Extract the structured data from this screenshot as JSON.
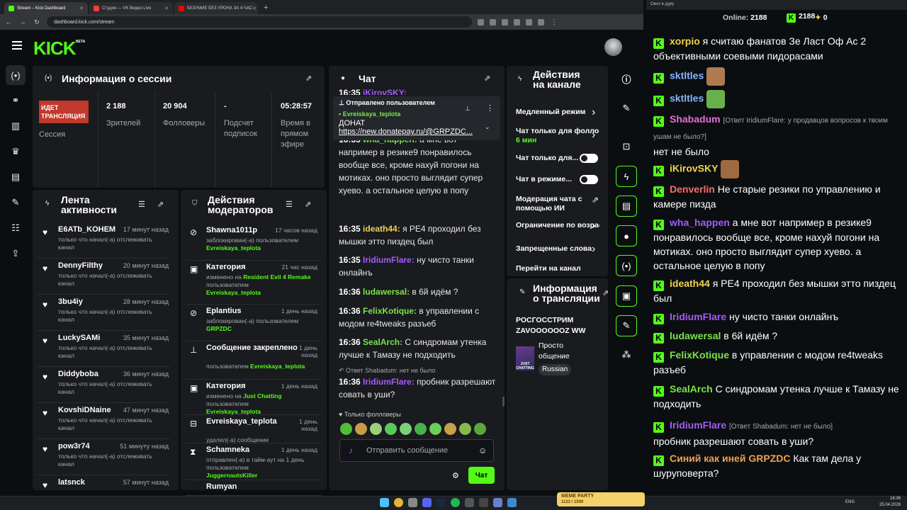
{
  "browser": {
    "tabs": [
      {
        "label": "Stream – Kick Dashboard",
        "color": "#53fc18"
      },
      {
        "label": "Студия — VK Видео Live",
        "color": "#ff3b3b"
      },
      {
        "label": "БЕЗУМИЕ БЕЗ УРОНА ЗА 4 ЧАС",
        "color": "#ff0000"
      }
    ],
    "url": "dashboard.kick.com/stream",
    "popout_title": "Окно в дуру"
  },
  "kick": {
    "logo": "KICK",
    "beta": "BETA"
  },
  "session": {
    "title": "Информация о сессии",
    "badge": "ИДЕТ ТРАНСЛЯЦИЯ",
    "badge_label": "Сессия",
    "stats": [
      {
        "value": "2 188",
        "label": "Зрителей"
      },
      {
        "value": "20 904",
        "label": "Фолловеры"
      },
      {
        "value": "-",
        "label": "Подсчет подписок"
      },
      {
        "value": "05:28:57",
        "label": "Время в прямом эфире"
      }
    ]
  },
  "activity": {
    "title": "Лента активности",
    "items": [
      {
        "name": "E6ATb_KOHEM",
        "time": "17 минут назад",
        "desc": "только что начал(-а) отслеживать канал"
      },
      {
        "name": "DennyFilthy",
        "time": "20 минут назад",
        "desc": "только что начал(-а) отслеживать канал"
      },
      {
        "name": "3bu4iy",
        "time": "28 минут назад",
        "desc": "только что начал(-а) отслеживать канал"
      },
      {
        "name": "LuckySAMi",
        "time": "35 минут назад",
        "desc": "только что начал(-а) отслеживать канал"
      },
      {
        "name": "Diddyboba",
        "time": "36 минут назад",
        "desc": "только что начал(-а) отслеживать канал"
      },
      {
        "name": "KovshiDNaine",
        "time": "47 минут назад",
        "desc": "только что начал(-а) отслеживать канал"
      },
      {
        "name": "pow3r74",
        "time": "51 минуту назад",
        "desc": "только что начал(-а) отслеживать канал"
      },
      {
        "name": "latsnck",
        "time": "57 минут назад",
        "desc": ""
      }
    ]
  },
  "mod": {
    "title": "Действия модераторов",
    "items": [
      {
        "icon": "⊘",
        "name": "Shawna1011p",
        "time": "17 часов назад",
        "d1": "заблокирован(-а) пользователем",
        "d2": "Evreiskaya_teplota"
      },
      {
        "icon": "▣",
        "name": "Категория",
        "time": "21 час назад",
        "d1": "изменено на",
        "d1g": "Resident Evil 4 Remake",
        "d1b": "пользователем",
        "d2": "Evreiskaya_teplota"
      },
      {
        "icon": "⊘",
        "name": "Eplantius",
        "time": "1 день назад",
        "d1": "заблокирован(-а) пользователем",
        "d2": "GRPZDC"
      },
      {
        "icon": "⊥",
        "name": "Сообщение закреплено",
        "time": "1 день назад",
        "d1": "пользователем",
        "d1g": "Evreiskaya_teplota"
      },
      {
        "icon": "▣",
        "name": "Категория",
        "time": "1 день назад",
        "d1": "изменено на",
        "d1g": "Just Chatting",
        "d1b": "пользователем",
        "d2": "Evreiskaya_teplota"
      },
      {
        "icon": "⊟",
        "name": "Evreiskaya_teplota",
        "time": "1 день назад",
        "d1": "удалил(-а) сообщение"
      },
      {
        "icon": "⧗",
        "name": "Schamneka",
        "time": "1 день назад",
        "d1": "отправлен(-а) в тайм-аут на 1 день пользователем",
        "d2": "JuggernautsKiller"
      },
      {
        "icon": "",
        "name": "Rumyan",
        "time": "",
        "d1": ""
      }
    ]
  },
  "chat": {
    "title": "Чат",
    "pinned": {
      "header": "Отправлено пользователем",
      "user": "Evreiskaya_teplota",
      "line1": "ДОНАТ",
      "line2": "https://new.donatepay.ru/@GRPZDC..."
    },
    "top_partial": {
      "time": "16:35",
      "user": "iKirovSKY:"
    },
    "partial": {
      "time": "16:35",
      "user": "wha_happen:",
      "text": "а мне вот например в резике9 понравилось вообще все, кроме нахуй погони на мотиках. оно просто выглядит супер хуево. а остальное целую в попу"
    },
    "messages": [
      {
        "time": "16:35",
        "user": "ideath44:",
        "color": "#f1d34b",
        "text": "я РЕ4 проходил без мышки этто пиздец был"
      },
      {
        "time": "16:35",
        "user": "IridiumFlare:",
        "color": "#a25df5",
        "text": "ну чисто танки онлайнъ"
      },
      {
        "time": "16:36",
        "user": "ludawersal:",
        "color": "#7ae34a",
        "text": "в 6й идём ?"
      },
      {
        "time": "16:36",
        "user": "FelixKotique:",
        "color": "#7ae34a",
        "text": "в управлении с модом re4tweaks разъеб"
      },
      {
        "time": "16:36",
        "user": "SealArch:",
        "color": "#7ae34a",
        "text": "С синдромам утенка лучше к Тамазу не подходить"
      }
    ],
    "reply_note": "Ответ Shabadum: нет не было",
    "last": {
      "time": "16:36",
      "user": "IridiumFlare:",
      "color": "#a25df5",
      "text": "пробник разрешают совать в уши?"
    },
    "followers_only": "Только фолловеры",
    "input_placeholder": "Отправить сообщение",
    "send_label": "Чат"
  },
  "channel": {
    "title": "Действия на канале",
    "items": [
      {
        "label": "Медленный режим",
        "control": "chevron"
      },
      {
        "label": "Чат только для фолловеров",
        "sub": "6 мин",
        "control": "chevron"
      },
      {
        "label": "Чат только для...",
        "control": "toggle"
      },
      {
        "label": "Чат в режиме...",
        "control": "toggle"
      },
      {
        "label": "Модерация чата с помощью ИИ",
        "control": "ext"
      },
      {
        "label": "Ограничение по возрасту",
        "control": "chevron"
      },
      {
        "label": "Запрещенные слова",
        "control": "chevron"
      },
      {
        "label": "Перейти на канал",
        "control": "none"
      }
    ]
  },
  "stream_info": {
    "title": "Информация о трансляции",
    "stream_title": "РОСГОССТРИМ ZAVOOOOOOZ WW",
    "category": "Просто общение",
    "language": "Russian",
    "thumb_text": "JUST CHATTING"
  },
  "popout": {
    "online_label": "Online:",
    "online_value": "2188",
    "kick_count": "2188",
    "other_count": "0",
    "messages": [
      {
        "user": "xorpio",
        "color": "#f1d34b",
        "text": "я считаю фанатов Зе Ласт Оф Ас 2 объективными соевыми пидорасами"
      },
      {
        "user": "sktltles",
        "color": "#8ab4ff",
        "text": "",
        "emote": "face"
      },
      {
        "user": "sktltles",
        "color": "#8ab4ff",
        "text": "",
        "emote": "frog"
      },
      {
        "user": "Shabadum",
        "color": "#e36fd8",
        "reply": "[Ответ IridiumFlare: у продавцов вопросов к твоим ушам не было?]",
        "text": "нет не было"
      },
      {
        "user": "iKirovSKY",
        "color": "#f1d34b",
        "text": "",
        "emote": "face2"
      },
      {
        "user": "Denverlin",
        "color": "#ff6a6a",
        "text": "Не старые резики по управлению и камере пизда"
      },
      {
        "user": "wha_happen",
        "color": "#a25df5",
        "text": "а мне вот например в резике9 понравилось вообще все, кроме нахуй погони на мотиках. оно просто выглядит супер хуево. а остальное целую в попу"
      },
      {
        "user": "ideath44",
        "color": "#f1d34b",
        "text": "я РЕ4 проходил без мышки этто пиздец был"
      },
      {
        "user": "IridiumFlare",
        "color": "#a25df5",
        "text": "ну чисто танки онлайнъ"
      },
      {
        "user": "ludawersal",
        "color": "#7ae34a",
        "text": "в 6й идём ?"
      },
      {
        "user": "FelixKotique",
        "color": "#7ae34a",
        "text": "в управлении с модом re4tweaks разъеб"
      },
      {
        "user": "SealArch",
        "color": "#7ae34a",
        "text": "С синдромам утенка лучше к Тамазу не подходить"
      },
      {
        "user": "IridiumFlare",
        "color": "#a25df5",
        "reply": "[Ответ Shabadum: нет не было]",
        "text": "пробник разрешают совать в уши?"
      },
      {
        "user": "Синий как иней",
        "user2": "GRPZDC",
        "color": "#f0a050",
        "text": "Как там дела у шуруповерта?"
      }
    ]
  },
  "taskbar": {
    "lang": "ENG",
    "time": "16:36",
    "date": "25.04.2026",
    "banner": "MEME PARTY",
    "banner_sub": "1123 / 1500"
  },
  "colors": {
    "accent": "#53fc18",
    "bg": "#0b0e10",
    "panel": "#191b1f",
    "live": "#c0392b"
  }
}
